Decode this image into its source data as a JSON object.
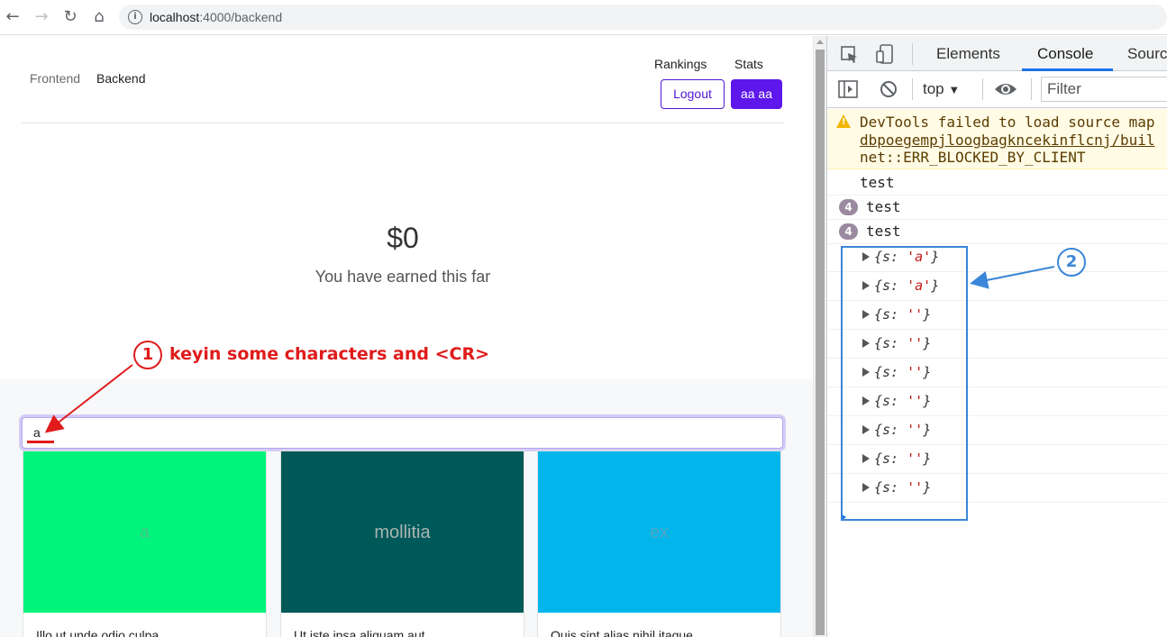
{
  "browser": {
    "url_host": "localhost",
    "url_path": ":4000/backend",
    "icons": {
      "back": "arrow-left-icon",
      "forward": "arrow-right-icon",
      "reload": "reload-icon",
      "home": "home-icon",
      "info": "info-icon"
    }
  },
  "page": {
    "nav": {
      "frontend": "Frontend",
      "backend": "Backend",
      "rankings": "Rankings",
      "stats": "Stats"
    },
    "buttons": {
      "logout": "Logout",
      "user": "aa aa"
    },
    "earned": {
      "amount": "$0",
      "label": "You have earned this far"
    },
    "search": {
      "value": "a"
    },
    "cards": [
      {
        "image_text": "a",
        "title": "Illo ut unde odio culpa",
        "bg": "#00f47b",
        "fg": "#48c28a"
      },
      {
        "image_text": "mollitia",
        "title": "Ut iste ipsa aliquam aut",
        "bg": "#005959",
        "fg": "#a9b4b4"
      },
      {
        "image_text": "ex",
        "title": "Quis sint alias nihil itaque",
        "bg": "#02b6ec",
        "fg": "#4fa6c0"
      }
    ]
  },
  "devtools": {
    "tabs": [
      "Elements",
      "Console",
      "Sourc"
    ],
    "active_tab": "Console",
    "context": "top",
    "filter_placeholder": "Filter",
    "warning": {
      "line1": "DevTools failed to load source map",
      "line2": "dbpoegempjloogbagkncekinflcnj/buil",
      "line3": "net::ERR_BLOCKED_BY_CLIENT"
    },
    "logs": [
      {
        "text": "test",
        "badge": ""
      },
      {
        "text": "test",
        "badge": "4"
      },
      {
        "text": "test",
        "badge": "4"
      }
    ],
    "objects": [
      {
        "prefix": "{s: ",
        "value": "'a'",
        "suffix": "}"
      },
      {
        "prefix": "{s: ",
        "value": "'a'",
        "suffix": "}"
      },
      {
        "prefix": "{s: ",
        "value": "''",
        "suffix": "}"
      },
      {
        "prefix": "{s: ",
        "value": "''",
        "suffix": "}"
      },
      {
        "prefix": "{s: ",
        "value": "''",
        "suffix": "}"
      },
      {
        "prefix": "{s: ",
        "value": "''",
        "suffix": "}"
      },
      {
        "prefix": "{s: ",
        "value": "''",
        "suffix": "}"
      },
      {
        "prefix": "{s: ",
        "value": "''",
        "suffix": "}"
      },
      {
        "prefix": "{s: ",
        "value": "''",
        "suffix": "}"
      }
    ]
  },
  "annotations": {
    "step1_number": "1",
    "step1_text": "keyin some characters and <CR>",
    "step2_number": "2"
  }
}
